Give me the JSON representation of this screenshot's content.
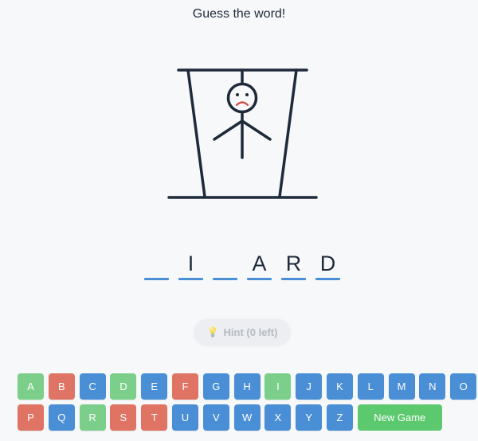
{
  "title": "Guess the word!",
  "word": {
    "slots": [
      "",
      "I",
      "",
      "A",
      "R",
      "D"
    ]
  },
  "hint": {
    "icon": "lightbulb-icon",
    "label": "Hint (0 left)",
    "enabled": false
  },
  "keyboard": {
    "keys": [
      {
        "letter": "A",
        "state": "correct"
      },
      {
        "letter": "B",
        "state": "wrong"
      },
      {
        "letter": "C",
        "state": "unused"
      },
      {
        "letter": "D",
        "state": "correct"
      },
      {
        "letter": "E",
        "state": "unused"
      },
      {
        "letter": "F",
        "state": "wrong"
      },
      {
        "letter": "G",
        "state": "unused"
      },
      {
        "letter": "H",
        "state": "unused"
      },
      {
        "letter": "I",
        "state": "correct"
      },
      {
        "letter": "J",
        "state": "unused"
      },
      {
        "letter": "K",
        "state": "unused"
      },
      {
        "letter": "L",
        "state": "unused"
      },
      {
        "letter": "M",
        "state": "unused"
      },
      {
        "letter": "N",
        "state": "unused"
      },
      {
        "letter": "O",
        "state": "unused"
      },
      {
        "letter": "P",
        "state": "wrong"
      },
      {
        "letter": "Q",
        "state": "unused"
      },
      {
        "letter": "R",
        "state": "correct"
      },
      {
        "letter": "S",
        "state": "wrong"
      },
      {
        "letter": "T",
        "state": "wrong"
      },
      {
        "letter": "U",
        "state": "unused"
      },
      {
        "letter": "V",
        "state": "unused"
      },
      {
        "letter": "W",
        "state": "unused"
      },
      {
        "letter": "X",
        "state": "unused"
      },
      {
        "letter": "Y",
        "state": "unused"
      },
      {
        "letter": "Z",
        "state": "unused"
      }
    ],
    "new_game_label": "New Game"
  },
  "colors": {
    "unused": "#4a8fd6",
    "correct": "#7ccf8a",
    "wrong": "#e07464",
    "new_game": "#5cc96f",
    "drawing": "#1e2a3a",
    "frown": "#d9403a"
  }
}
